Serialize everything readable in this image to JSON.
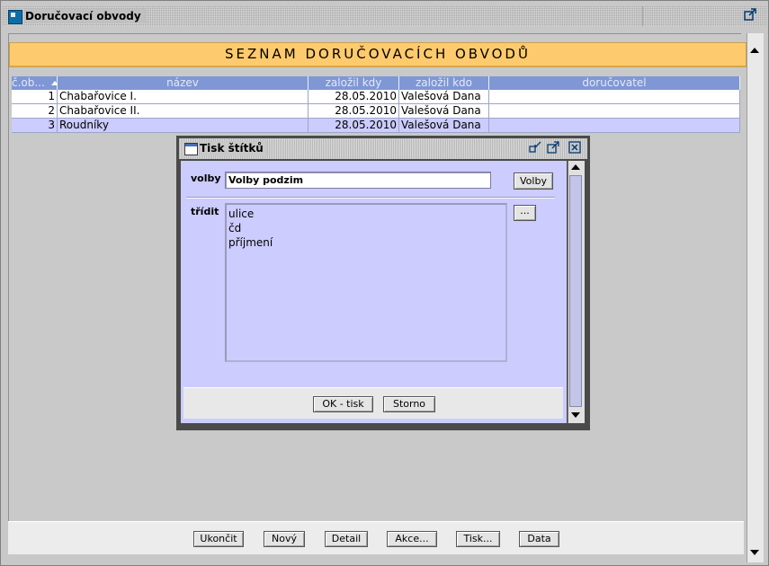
{
  "window": {
    "title": "Doručovací obvody",
    "maximize_icon": "maximize-icon"
  },
  "banner": "SEZNAM DORUČOVACÍCH OBVODŮ",
  "table": {
    "columns": [
      "č.ob...",
      "název",
      "založil kdy",
      "založil kdo",
      "doručovatel"
    ],
    "rows": [
      {
        "cislo": "1",
        "nazev": "Chabařovice I.",
        "kdy": "28.05.2010",
        "kdo": "Valešová Dana",
        "dorucovatel": ""
      },
      {
        "cislo": "2",
        "nazev": "Chabařovice II.",
        "kdy": "28.05.2010",
        "kdo": "Valešová Dana",
        "dorucovatel": ""
      },
      {
        "cislo": "3",
        "nazev": "Roudníky",
        "kdy": "28.05.2010",
        "kdo": "Valešová Dana",
        "dorucovatel": ""
      }
    ],
    "colors": {
      "header": "#7f97d4",
      "selected_row": "#ccccfe",
      "row": "#ffffff"
    }
  },
  "bottom_buttons": {
    "ukoncit": "Ukončit",
    "novy": "Nový",
    "detail": "Detail",
    "akce": "Akce...",
    "tisk": "Tisk...",
    "data": "Data"
  },
  "dialog": {
    "title": "Tisk štítků",
    "volby_label": "volby",
    "volby_value": "Volby podzim",
    "volby_button": "Volby",
    "tridit_label": "třídit",
    "tridit_button": "...",
    "tridit_items": [
      "ulice",
      "čd",
      "příjmení"
    ],
    "ok_button": "OK - tisk",
    "storno_button": "Storno"
  }
}
